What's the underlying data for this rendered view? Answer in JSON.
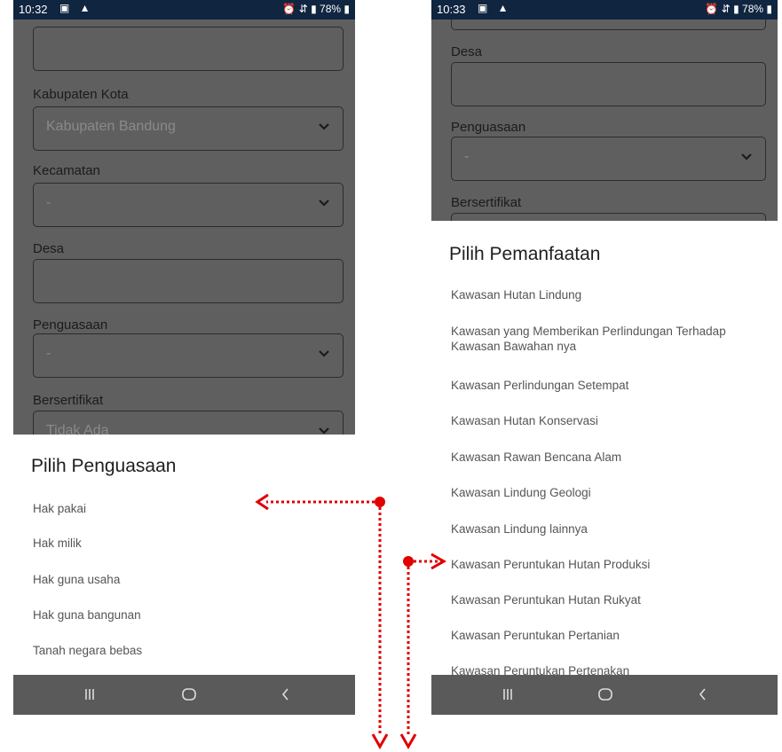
{
  "left": {
    "status": {
      "time": "10:32",
      "right": "78%"
    },
    "form": {
      "kabupaten_label": "Kabupaten Kota",
      "kabupaten_value": "Kabupaten Bandung",
      "kecamatan_label": "Kecamatan",
      "kecamatan_value": "-",
      "desa_label": "Desa",
      "penguasaan_label": "Penguasaan",
      "penguasaan_value": "-",
      "bersertifikat_label": "Bersertifikat",
      "bersertifikat_value": "Tidak Ada"
    },
    "sheet": {
      "title": "Pilih Penguasaan",
      "options": [
        "Hak pakai",
        "Hak milik",
        "Hak guna usaha",
        "Hak guna bangunan",
        "Tanah negara bebas"
      ]
    }
  },
  "right": {
    "status": {
      "time": "10:33",
      "right": "78%"
    },
    "form": {
      "desa_label": "Desa",
      "penguasaan_label": "Penguasaan",
      "penguasaan_value": "-",
      "bersertifikat_label": "Bersertifikat"
    },
    "sheet": {
      "title": "Pilih Pemanfaatan",
      "options": [
        "Kawasan Hutan Lindung",
        "Kawasan yang Memberikan Perlindungan Terhadap Kawasan Bawahan nya",
        "Kawasan Perlindungan Setempat",
        "Kawasan Hutan Konservasi",
        "Kawasan Rawan Bencana Alam",
        "Kawasan Lindung Geologi",
        "Kawasan Lindung lainnya",
        "Kawasan Peruntukan Hutan Produksi",
        "Kawasan Peruntukan Hutan Rukyat",
        "Kawasan Peruntukan Pertanian",
        "Kawasan Peruntukan Pertenakan"
      ]
    }
  },
  "navbar": {
    "icons": [
      "recent-apps-icon",
      "home-icon",
      "back-icon"
    ]
  },
  "colors": {
    "statusbar": "#0f2540",
    "overlay": "#5f5f5f",
    "navbar": "#5a5a5a",
    "annotation": "#e00000"
  }
}
